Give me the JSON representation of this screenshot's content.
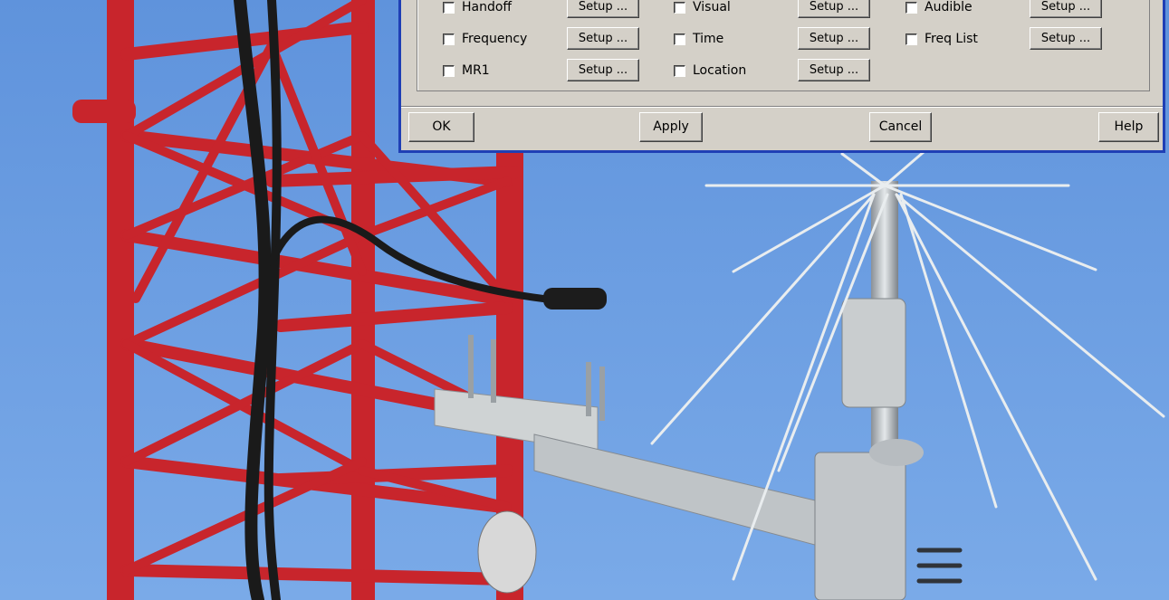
{
  "options": [
    [
      {
        "label": "Handoff",
        "checked": false,
        "setup": "Setup ..."
      },
      {
        "label": "Visual",
        "checked": false,
        "setup": "Setup ..."
      },
      {
        "label": "Audible",
        "checked": false,
        "setup": "Setup ..."
      }
    ],
    [
      {
        "label": "Frequency",
        "checked": false,
        "setup": "Setup ..."
      },
      {
        "label": "Time",
        "checked": false,
        "setup": "Setup ..."
      },
      {
        "label": "Freq List",
        "checked": false,
        "setup": "Setup ..."
      }
    ],
    [
      {
        "label": "MR1",
        "checked": false,
        "setup": "Setup ..."
      },
      {
        "label": "Location",
        "checked": false,
        "setup": "Setup ..."
      }
    ]
  ],
  "buttons": {
    "ok": "OK",
    "apply": "Apply",
    "cancel": "Cancel",
    "help": "Help"
  },
  "colors": {
    "dialog_bg": "#d4d0c8",
    "dialog_border": "#1f3fb5",
    "sky": "#6d9fe2",
    "tower_red": "#c8252c"
  }
}
